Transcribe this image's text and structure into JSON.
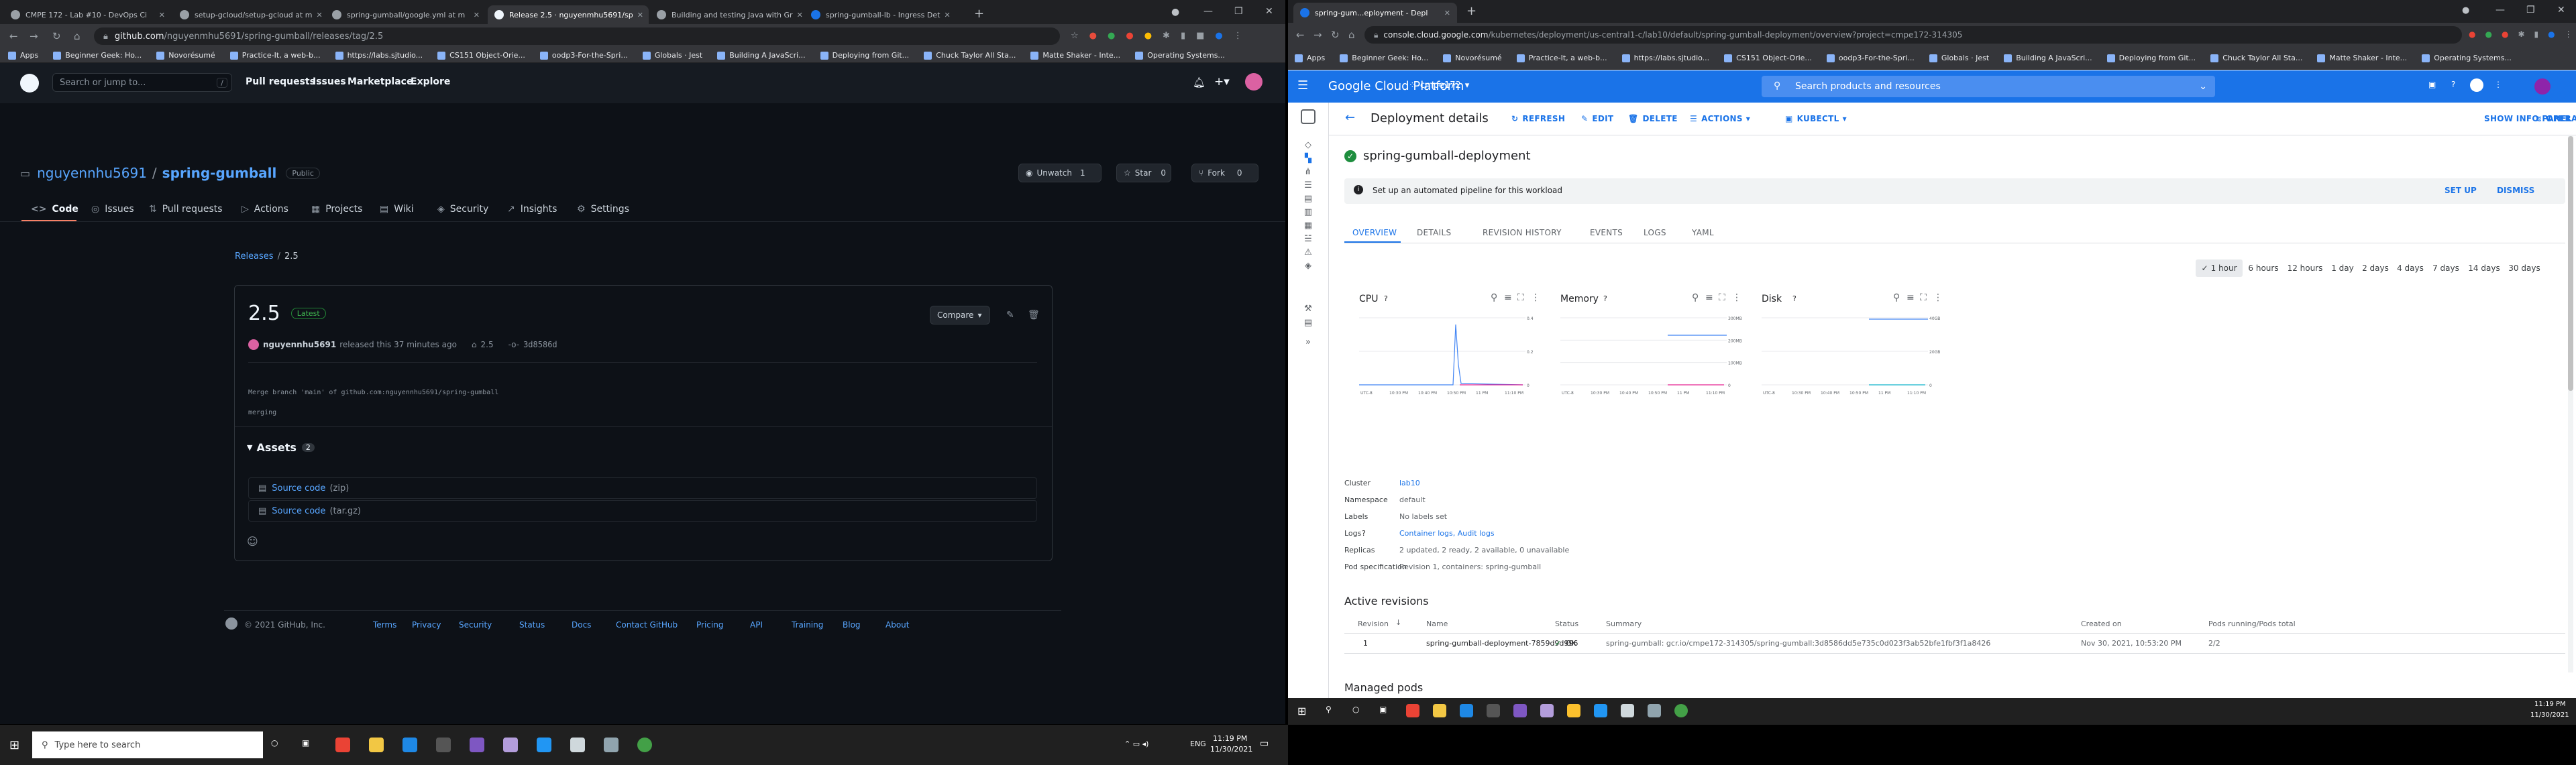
{
  "left_browser": {
    "tabs": [
      {
        "title": "CMPE 172 - Lab #10 - DevOps Ci"
      },
      {
        "title": "setup-gcloud/setup-gcloud at m"
      },
      {
        "title": "spring-gumball/google.yml at m"
      },
      {
        "title": "Release 2.5 · nguyenmhu5691/sp"
      },
      {
        "title": "Building and testing Java with Gr"
      },
      {
        "title": "spring-gumball-lb - Ingress Det"
      }
    ],
    "new_tab": "+",
    "url_host": "github.com",
    "url_path": "/nguyenmhu5691/spring-gumball/releases/tag/2.5",
    "bookmarks": [
      "Apps",
      "Beginner Geek: Ho...",
      "Novorésumé",
      "Practice-It, a web-b...",
      "https://labs.sjtudio...",
      "CS151 Object-Orie...",
      "oodp3-For-the-Spri...",
      "Globals · Jest",
      "Building A JavaScri...",
      "Deploying from Git...",
      "Chuck Taylor All Sta...",
      "Matte Shaker - Inte...",
      "Operating Systems..."
    ]
  },
  "github": {
    "search_placeholder": "Search or jump to...",
    "search_shortcut": "/",
    "nav": [
      "Pull requests",
      "Issues",
      "Marketplace",
      "Explore"
    ],
    "owner": "nguyennhu5691",
    "separator": "/",
    "repo": "spring-gumball",
    "visibility": "Public",
    "unwatch_label": "Unwatch",
    "unwatch_count": "1",
    "star_label": "Star",
    "star_count": "0",
    "fork_label": "Fork",
    "fork_count": "0",
    "repo_tabs": [
      "Code",
      "Issues",
      "Pull requests",
      "Actions",
      "Projects",
      "Wiki",
      "Security",
      "Insights",
      "Settings"
    ],
    "breadcrumb_root": "Releases",
    "breadcrumb_sep": "/",
    "breadcrumb_leaf": "2.5",
    "release": {
      "title": "2.5",
      "badge": "Latest",
      "compare_label": "Compare",
      "author": "nguyennhu5691",
      "released_text": "released this 37 minutes ago",
      "tag": "2.5",
      "commit": "3d8586d",
      "body_line1": "Merge branch 'main' of github.com:nguyennhu5691/spring-gumball",
      "body_line2": "merging",
      "assets_label": "Assets",
      "assets_count": "2",
      "assets": [
        {
          "name": "Source code",
          "kind": "(zip)"
        },
        {
          "name": "Source code",
          "kind": "(tar.gz)"
        }
      ]
    },
    "footer_copyright": "© 2021 GitHub, Inc.",
    "footer_links": [
      "Terms",
      "Privacy",
      "Security",
      "Status",
      "Docs",
      "Contact GitHub",
      "Pricing",
      "API",
      "Training",
      "Blog",
      "About"
    ]
  },
  "right_browser": {
    "tab_title": "spring-gum...eployment - Depl",
    "new_tab": "+",
    "url_host": "console.cloud.google.com",
    "url_path": "/kubernetes/deployment/us-central1-c/lab10/default/spring-gumball-deployment/overview?project=cmpe172-314305",
    "bookmarks": [
      "Apps",
      "Beginner Geek: Ho...",
      "Novorésumé",
      "Practice-It, a web-b...",
      "https://labs.sjtudio...",
      "CS151 Object-Orie...",
      "oodp3-For-the-Spri...",
      "Globals · Jest",
      "Building A JavaScri...",
      "Deploying from Git...",
      "Chuck Taylor All Sta...",
      "Matte Shaker - Inte...",
      "Operating Systems..."
    ]
  },
  "gcp": {
    "product": "Google Cloud Platform",
    "project": "cmpe172",
    "search_placeholder": "Search products and resources",
    "page_title": "Deployment details",
    "actions": [
      "REFRESH",
      "EDIT",
      "DELETE",
      "ACTIONS",
      "KUBECTL"
    ],
    "show_info": "SHOW INFO PANEL",
    "operations": "OPERATIONS",
    "deployment_name": "spring-gumball-deployment",
    "pipeline_msg": "Set up an automated pipeline for this workload",
    "setup": "SET UP",
    "dismiss": "DISMISS",
    "tabs": [
      "OVERVIEW",
      "DETAILS",
      "REVISION HISTORY",
      "EVENTS",
      "LOGS",
      "YAML"
    ],
    "ranges": [
      "1 hour",
      "6 hours",
      "12 hours",
      "1 day",
      "2 days",
      "4 days",
      "7 days",
      "14 days",
      "30 days"
    ],
    "charts": [
      {
        "title": "CPU",
        "y_ticks": [
          "0.4",
          "0.2",
          "0"
        ],
        "x_ticks": [
          "UTC-8",
          "10:30 PM",
          "10:40 PM",
          "10:50 PM",
          "11 PM",
          "11:10 PM"
        ]
      },
      {
        "title": "Memory",
        "y_ticks": [
          "300MB",
          "200MB",
          "100MB",
          "0"
        ],
        "x_ticks": [
          "UTC-8",
          "10:30 PM",
          "10:40 PM",
          "10:50 PM",
          "11 PM",
          "11:10 PM"
        ]
      },
      {
        "title": "Disk",
        "y_ticks": [
          "40GB",
          "20GB",
          "0"
        ],
        "x_ticks": [
          "UTC-8",
          "10:30 PM",
          "10:40 PM",
          "10:50 PM",
          "11 PM",
          "11:10 PM"
        ]
      }
    ],
    "props": [
      {
        "label": "Cluster",
        "value": "lab10",
        "link": true
      },
      {
        "label": "Namespace",
        "value": "default",
        "link": false
      },
      {
        "label": "Labels",
        "value": "No labels set",
        "link": false
      },
      {
        "label": "Logs",
        "value": "Container logs, Audit logs",
        "link": true
      },
      {
        "label": "Replicas",
        "value": "2 updated, 2 ready, 2 available, 0 unavailable",
        "link": false
      },
      {
        "label": "Pod specification",
        "value": "Revision 1, containers: spring-gumball",
        "link": false
      }
    ],
    "active_revisions_title": "Active revisions",
    "rev_headers": [
      "Revision",
      "Name",
      "Status",
      "Summary",
      "Created on",
      "Pods running/Pods total"
    ],
    "rev_row": [
      "1",
      "spring-gumball-deployment-7859d9d996",
      "OK",
      "spring-gumball: gcr.io/cmpe172-314305/spring-gumball:3d8586dd5e735c0d023f3ab52bfe1fbf3f1a8426",
      "Nov 30, 2021, 10:53:20 PM",
      "2/2"
    ],
    "managed_pods": "Managed pods"
  },
  "taskbar_left": {
    "search": "Type here to search",
    "lang": "ENG",
    "time": "11:19 PM",
    "date": "11/30/2021"
  },
  "taskbar_right": {
    "time": "11:19 PM",
    "date": "11/30/2021"
  },
  "colors": {
    "gh_bg": "#0d1117",
    "gh_link": "#58a6ff",
    "gcp_blue": "#1a73e8",
    "ok_green": "#1e8e3e"
  }
}
